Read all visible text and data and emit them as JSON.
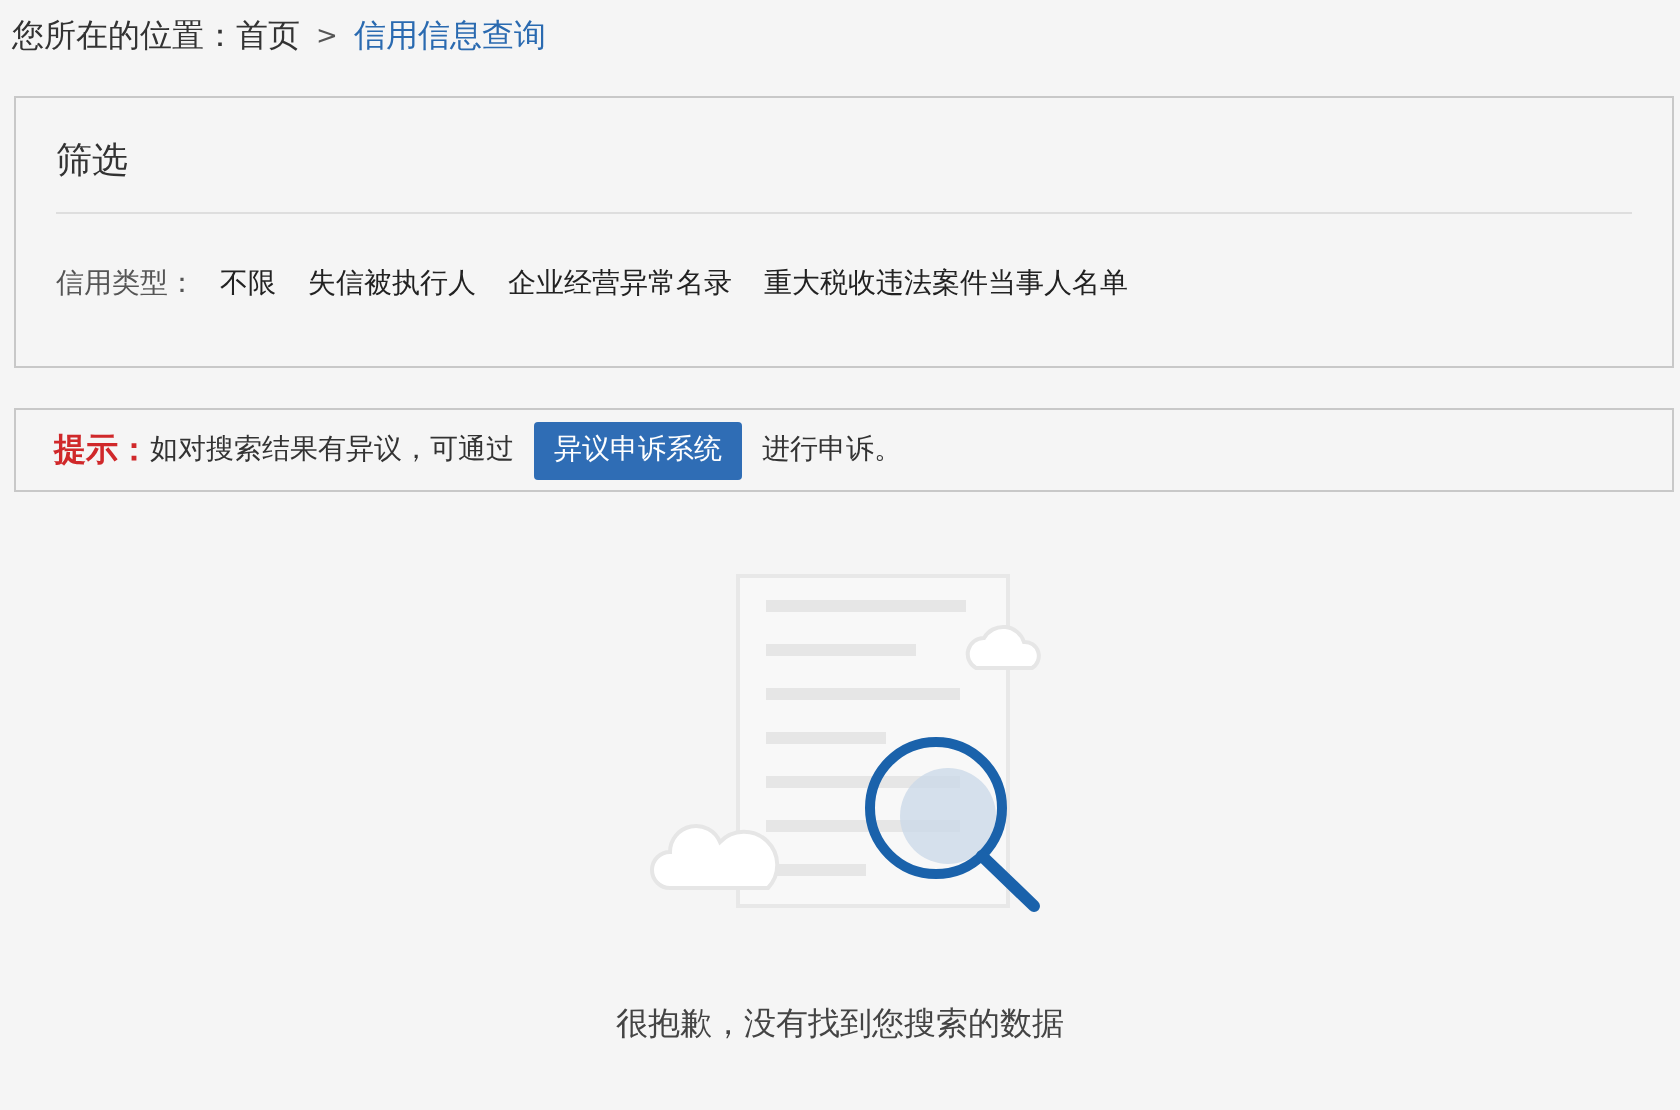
{
  "breadcrumb": {
    "label": "您所在的位置：",
    "items": [
      {
        "text": "首页",
        "kind": "link"
      },
      {
        "text": ">",
        "kind": "separator"
      },
      {
        "text": "信用信息查询",
        "kind": "current"
      }
    ]
  },
  "filter": {
    "title": "筛选",
    "label": "信用类型：",
    "options": [
      "不限",
      "失信被执行人",
      "企业经营异常名录",
      "重大税收违法案件当事人名单"
    ]
  },
  "notice": {
    "label": "提示：",
    "text": "如对搜索结果有异议，可通过",
    "button": "异议申诉系统",
    "suffix": "进行申诉。"
  },
  "empty": {
    "message": "很抱歉，没有找到您搜索的数据"
  }
}
